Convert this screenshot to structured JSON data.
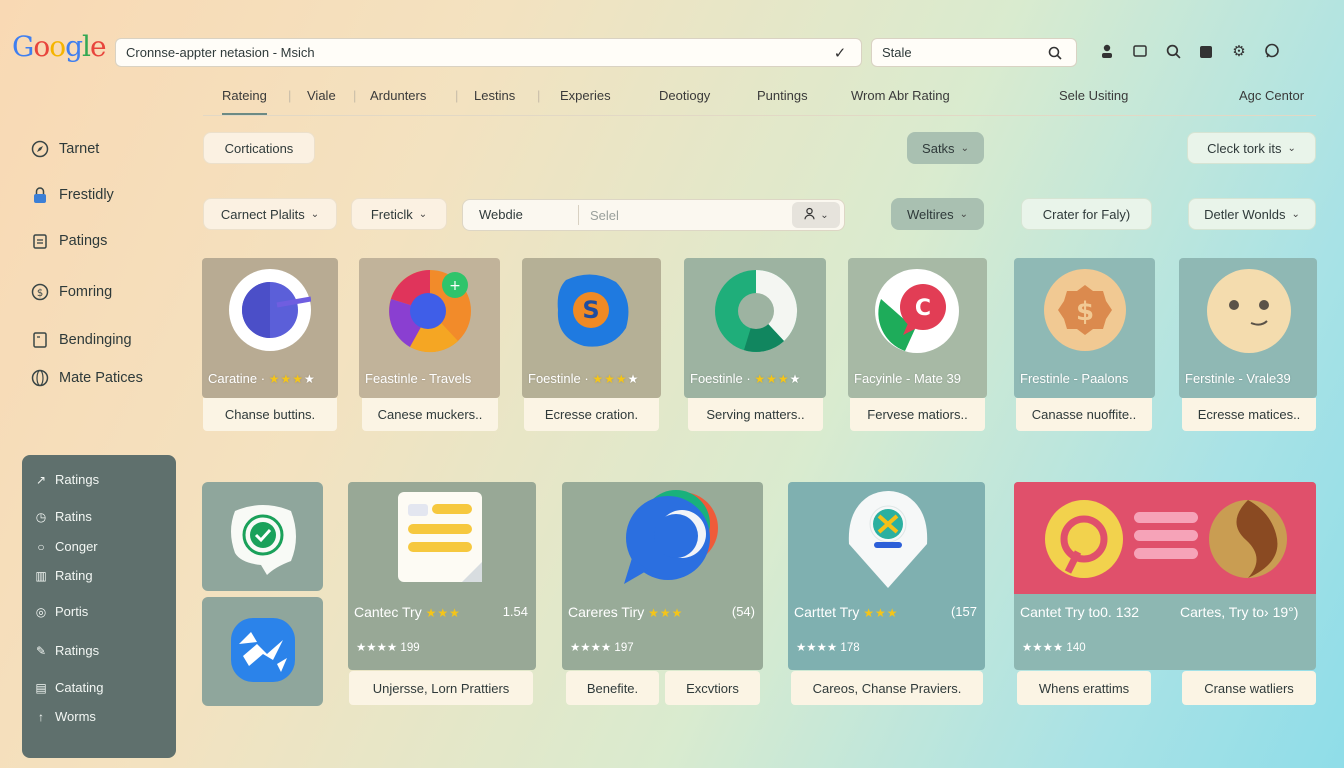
{
  "header": {
    "logo_letters": [
      "G",
      "o",
      "o",
      "g",
      "l",
      "e"
    ],
    "search_value": "Cronnse-appter netasion - Msich",
    "side_search_value": "Stale",
    "icons": [
      "user-icon",
      "folder-icon",
      "search-icon",
      "bag-icon",
      "settings-icon",
      "chat-icon"
    ]
  },
  "nav": {
    "tabs": [
      "Rateing",
      "Viale",
      "Ardunters",
      "Lestins",
      "Experies",
      "Deotiogy",
      "Puntings",
      "Wrom Abr Rating",
      "Sele Usiting",
      "Agc Centor"
    ]
  },
  "sidebar": {
    "items": [
      {
        "label": "Tarnet",
        "icon": "compass-icon"
      },
      {
        "label": "Frestidly",
        "icon": "lock-icon"
      },
      {
        "label": "Patings",
        "icon": "clipboard-icon"
      },
      {
        "label": "Fomring",
        "icon": "dollar-icon"
      },
      {
        "label": "Bendinging",
        "icon": "document-icon"
      },
      {
        "label": "Mate Patices",
        "icon": "globe-icon"
      }
    ],
    "panel": [
      {
        "label": "Ratings",
        "icon": "chart-icon"
      },
      {
        "label": "Ratins",
        "icon": "clock-icon"
      },
      {
        "label": "Conger",
        "icon": "circle-icon"
      },
      {
        "label": "Rating",
        "icon": "building-icon"
      },
      {
        "label": "Portis",
        "icon": "target-icon"
      },
      {
        "label": "Ratings",
        "icon": "pen-icon"
      },
      {
        "label": "Catating",
        "icon": "card-icon"
      },
      {
        "label": "Worms",
        "icon": "arrow-up-icon"
      }
    ]
  },
  "filters": {
    "certifications": "Cortications",
    "status": "Satks",
    "check": "Cleck tork its",
    "carrier": "Carnect Plalits",
    "freetick": "Freticlk",
    "search_label": "Webdie",
    "search_placeholder": "Selel",
    "weltires": "Weltires",
    "crater": "Crater for Faly)",
    "detler": "Detler Wonlds"
  },
  "cards_row1": [
    {
      "title": "Caratine",
      "stars": "★★★",
      "dim": "★",
      "sub": "Chanse buttins.",
      "bg": "#b8ab93"
    },
    {
      "title": "Feastinle - Travels",
      "stars": "",
      "dim": "",
      "sub": "Canese muckers..",
      "bg": "#c1b39a"
    },
    {
      "title": "Foestinle",
      "stars": "★★★",
      "dim": "★",
      "sub": "Ecresse cration.",
      "bg": "#b5b096"
    },
    {
      "title": "Foestinle",
      "stars": "★★★",
      "dim": "★",
      "sub": "Serving matters..",
      "bg": "#9db3a1"
    },
    {
      "title": "Facyinle - Mate 39",
      "stars": "",
      "dim": "",
      "sub": "Fervese matiors..",
      "bg": "#a7b9a5"
    },
    {
      "title": "Frestinle - Paalons",
      "stars": "",
      "dim": "",
      "sub": "Canasse nuoffite..",
      "bg": "#8fb9b5"
    },
    {
      "title": "Ferstinle - Vrale39",
      "stars": "",
      "dim": "",
      "sub": "Ecresse matices..",
      "bg": "#8fb8b4"
    }
  ],
  "cards_row2": [
    {
      "title": "Cantec Try",
      "stars": "★★★",
      "num": "1.54",
      "rating": "★★★★ 199",
      "bg": "#98a896"
    },
    {
      "title": "Careres Tiry",
      "stars": "★★★",
      "num": "(54)",
      "rating": "★★★★ 197",
      "bg": "#98ab98"
    },
    {
      "title": "Carttet Try",
      "stars": "★★★",
      "num": "(157",
      "rating": "★★★★ 178",
      "bg": "#7fb0b0"
    },
    {
      "title": "Cantet Try to0. 132",
      "stars": "",
      "num": "",
      "rating": "★★★★ 140",
      "bg": "#8db7b2"
    },
    {
      "title": "Cartes, Try to› 19°)",
      "stars": "",
      "num": "",
      "rating": "",
      "bg": "#8db7b2"
    }
  ],
  "subs_row2": [
    "Unjersse, Lorn Prattiers",
    "Benefite.",
    "Excvtiors",
    "Careos, Chanse Praviers.",
    "Whens erattims",
    "Cranse watliers"
  ],
  "colors": {
    "accent": "#6c8a84",
    "star": "#f5c518",
    "panel": "#5f706d",
    "pink": "#e0506b"
  }
}
